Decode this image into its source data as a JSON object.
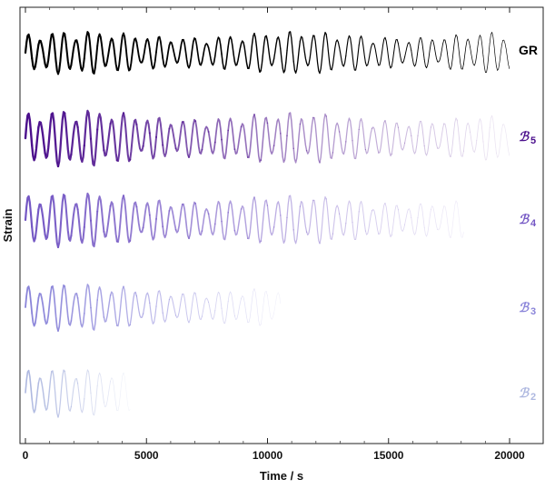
{
  "chart_data": {
    "type": "line",
    "title": "",
    "xlabel": "Time /  s",
    "ylabel": "Strain",
    "xlim": [
      0,
      20000
    ],
    "xticks": [
      0,
      5000,
      10000,
      15000,
      20000
    ],
    "xtick_labels": [
      "0",
      "5000",
      "10000",
      "15000",
      "20000"
    ],
    "grid": false,
    "legend": "right",
    "series": [
      {
        "key": "GR",
        "name": "GR",
        "color": "#000000",
        "end": 20000
      },
      {
        "key": "B5",
        "name": "ℬ",
        "subscript": "5",
        "color": "#4b0f8c",
        "end": 20000
      },
      {
        "key": "B4",
        "name": "ℬ",
        "subscript": "4",
        "color": "#7457c4",
        "end": 18300
      },
      {
        "key": "B3",
        "name": "ℬ",
        "subscript": "3",
        "color": "#8a84d9",
        "end": 10800
      },
      {
        "key": "B2",
        "name": "ℬ",
        "subscript": "2",
        "color": "#aeb8e0",
        "end": 4500
      }
    ]
  }
}
